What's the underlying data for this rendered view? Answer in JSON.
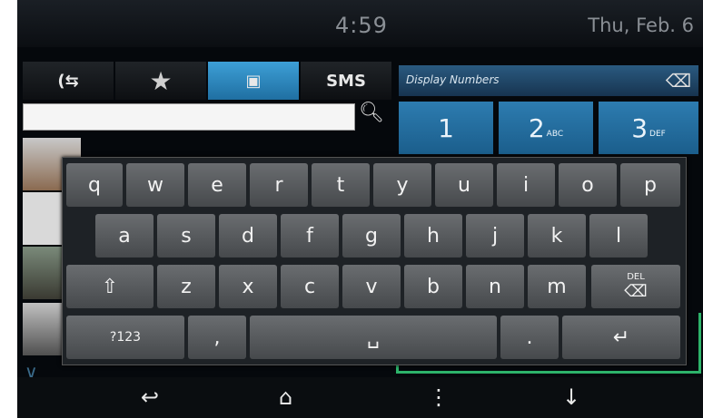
{
  "status": {
    "time": "4:59",
    "date": "Thu, Feb. 6"
  },
  "tabs": [
    {
      "name": "tab-recent-calls",
      "icon": "call-transfer-icon",
      "label": "(⇆"
    },
    {
      "name": "tab-favorites",
      "icon": "star-icon",
      "label": "★"
    },
    {
      "name": "tab-contacts",
      "icon": "contacts-icon",
      "label": "▣"
    },
    {
      "name": "tab-sms",
      "icon": "",
      "label": "SMS"
    }
  ],
  "search": {
    "value": "",
    "icon": "search-icon"
  },
  "dialpad": {
    "header_label": "Display Numbers",
    "backspace_icon": "backspace-icon",
    "keys": [
      {
        "digit": "1",
        "letters": ""
      },
      {
        "digit": "2",
        "letters": "ABC"
      },
      {
        "digit": "3",
        "letters": "DEF"
      }
    ]
  },
  "keyboard": {
    "row1": [
      "q",
      "w",
      "e",
      "r",
      "t",
      "y",
      "u",
      "i",
      "o",
      "p"
    ],
    "row2": [
      "a",
      "s",
      "d",
      "f",
      "g",
      "h",
      "j",
      "k",
      "l"
    ],
    "row3": [
      "z",
      "x",
      "c",
      "v",
      "b",
      "n",
      "m"
    ],
    "del_label": "DEL",
    "symbols_label": "?123",
    "comma_label": ",",
    "period_label": ".",
    "space_label": "␣",
    "shift_icon": "shift-icon",
    "enter_icon": "enter-icon"
  },
  "nav": {
    "back_icon": "back-icon",
    "home_icon": "home-icon",
    "menu_icon": "menu-icon",
    "mic_icon": "microphone-icon"
  },
  "colors": {
    "accent": "#2d7cb0",
    "active_tab": "#3d9fd6",
    "green_frame": "#2db36a"
  }
}
